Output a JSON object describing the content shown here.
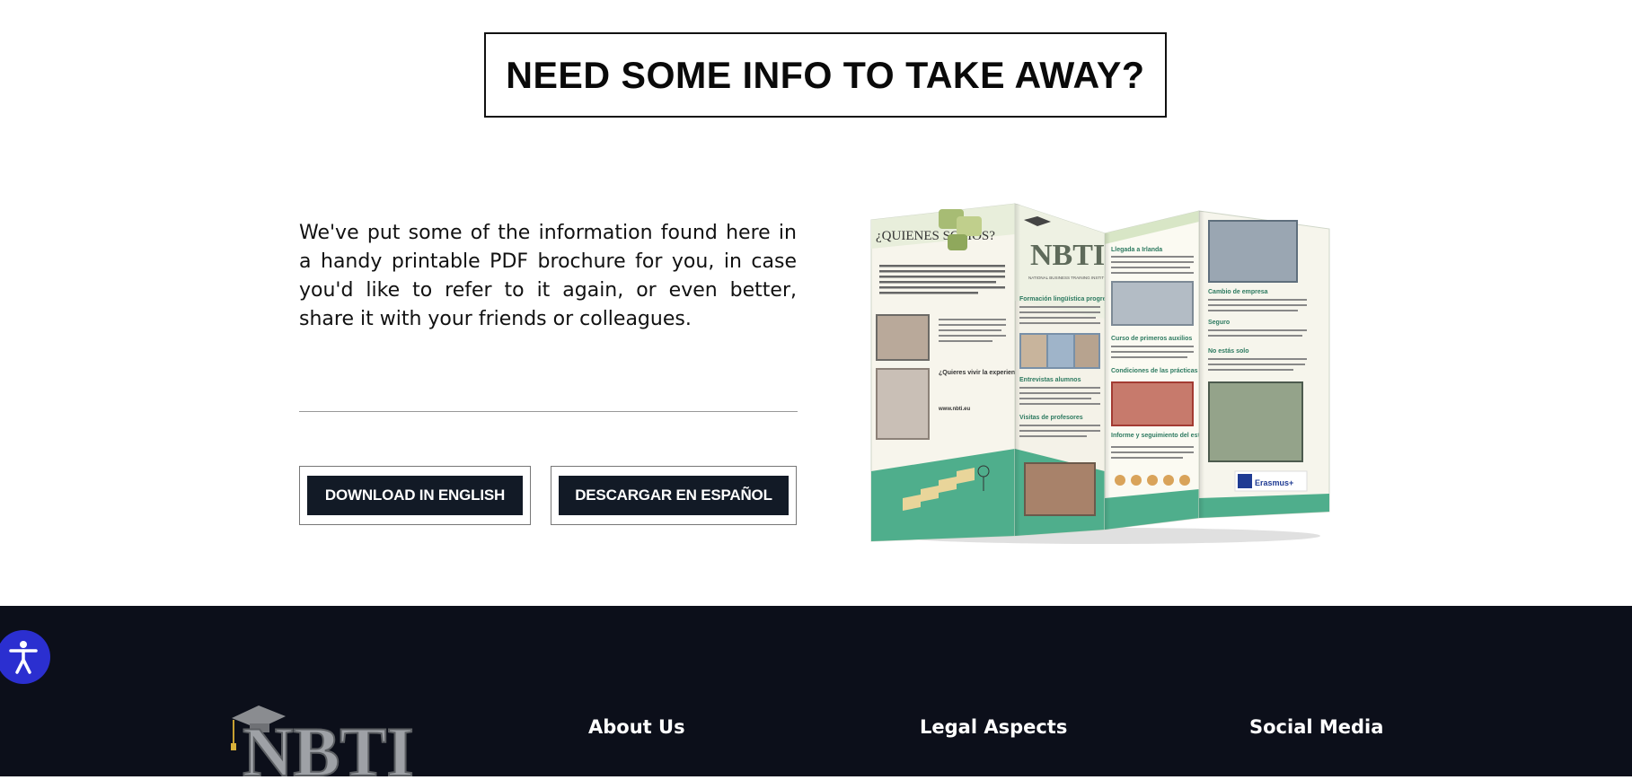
{
  "section": {
    "title": "NEED SOME INFO TO TAKE AWAY?",
    "description": "We've put some of the information found here in a handy printable PDF brochure for you, in case you'd like to refer to it again, or even better, share it with your friends or colleagues."
  },
  "buttons": {
    "english_label": "DOWNLOAD IN ENGLISH",
    "spanish_label": "DESCARGAR EN ESPAÑOL"
  },
  "brochure": {
    "panel1_heading": "¿QUIENES SOMOS?",
    "panel1_subheading": "¿Quieres vivir la experiencia con nosotros?",
    "panel1_site": "www.nbti.eu",
    "logo_text": "NBTI",
    "logo_subtext": "NATIONAL BUSINESS TRAINING INSTITUTE",
    "panel2_h1": "Formación lingüística progresiva",
    "panel2_h2": "Entrevistas alumnos",
    "panel2_h3": "Visitas de profesores",
    "panel3_h1": "Llegada a Irlanda",
    "panel3_h2": "Curso de primeros auxilios",
    "panel3_h3": "Condiciones de las prácticas",
    "panel3_h4": "Informe y seguimiento del estudiante",
    "panel4_h1": "Cambio de empresa",
    "panel4_h2": "Seguro",
    "panel4_h3": "No estás solo",
    "erasmus_label": "Erasmus+"
  },
  "footer": {
    "logo_text": "NBTI",
    "about_heading": "About Us",
    "legal_heading": "Legal Aspects",
    "social_heading": "Social Media",
    "accessibility_icon": "accessibility-icon"
  },
  "colors": {
    "footer_bg": "#0c0f1a",
    "button_bg": "#121a26",
    "accessibility_bg": "#2b2fd0",
    "brochure_green": "#4fae8c"
  }
}
